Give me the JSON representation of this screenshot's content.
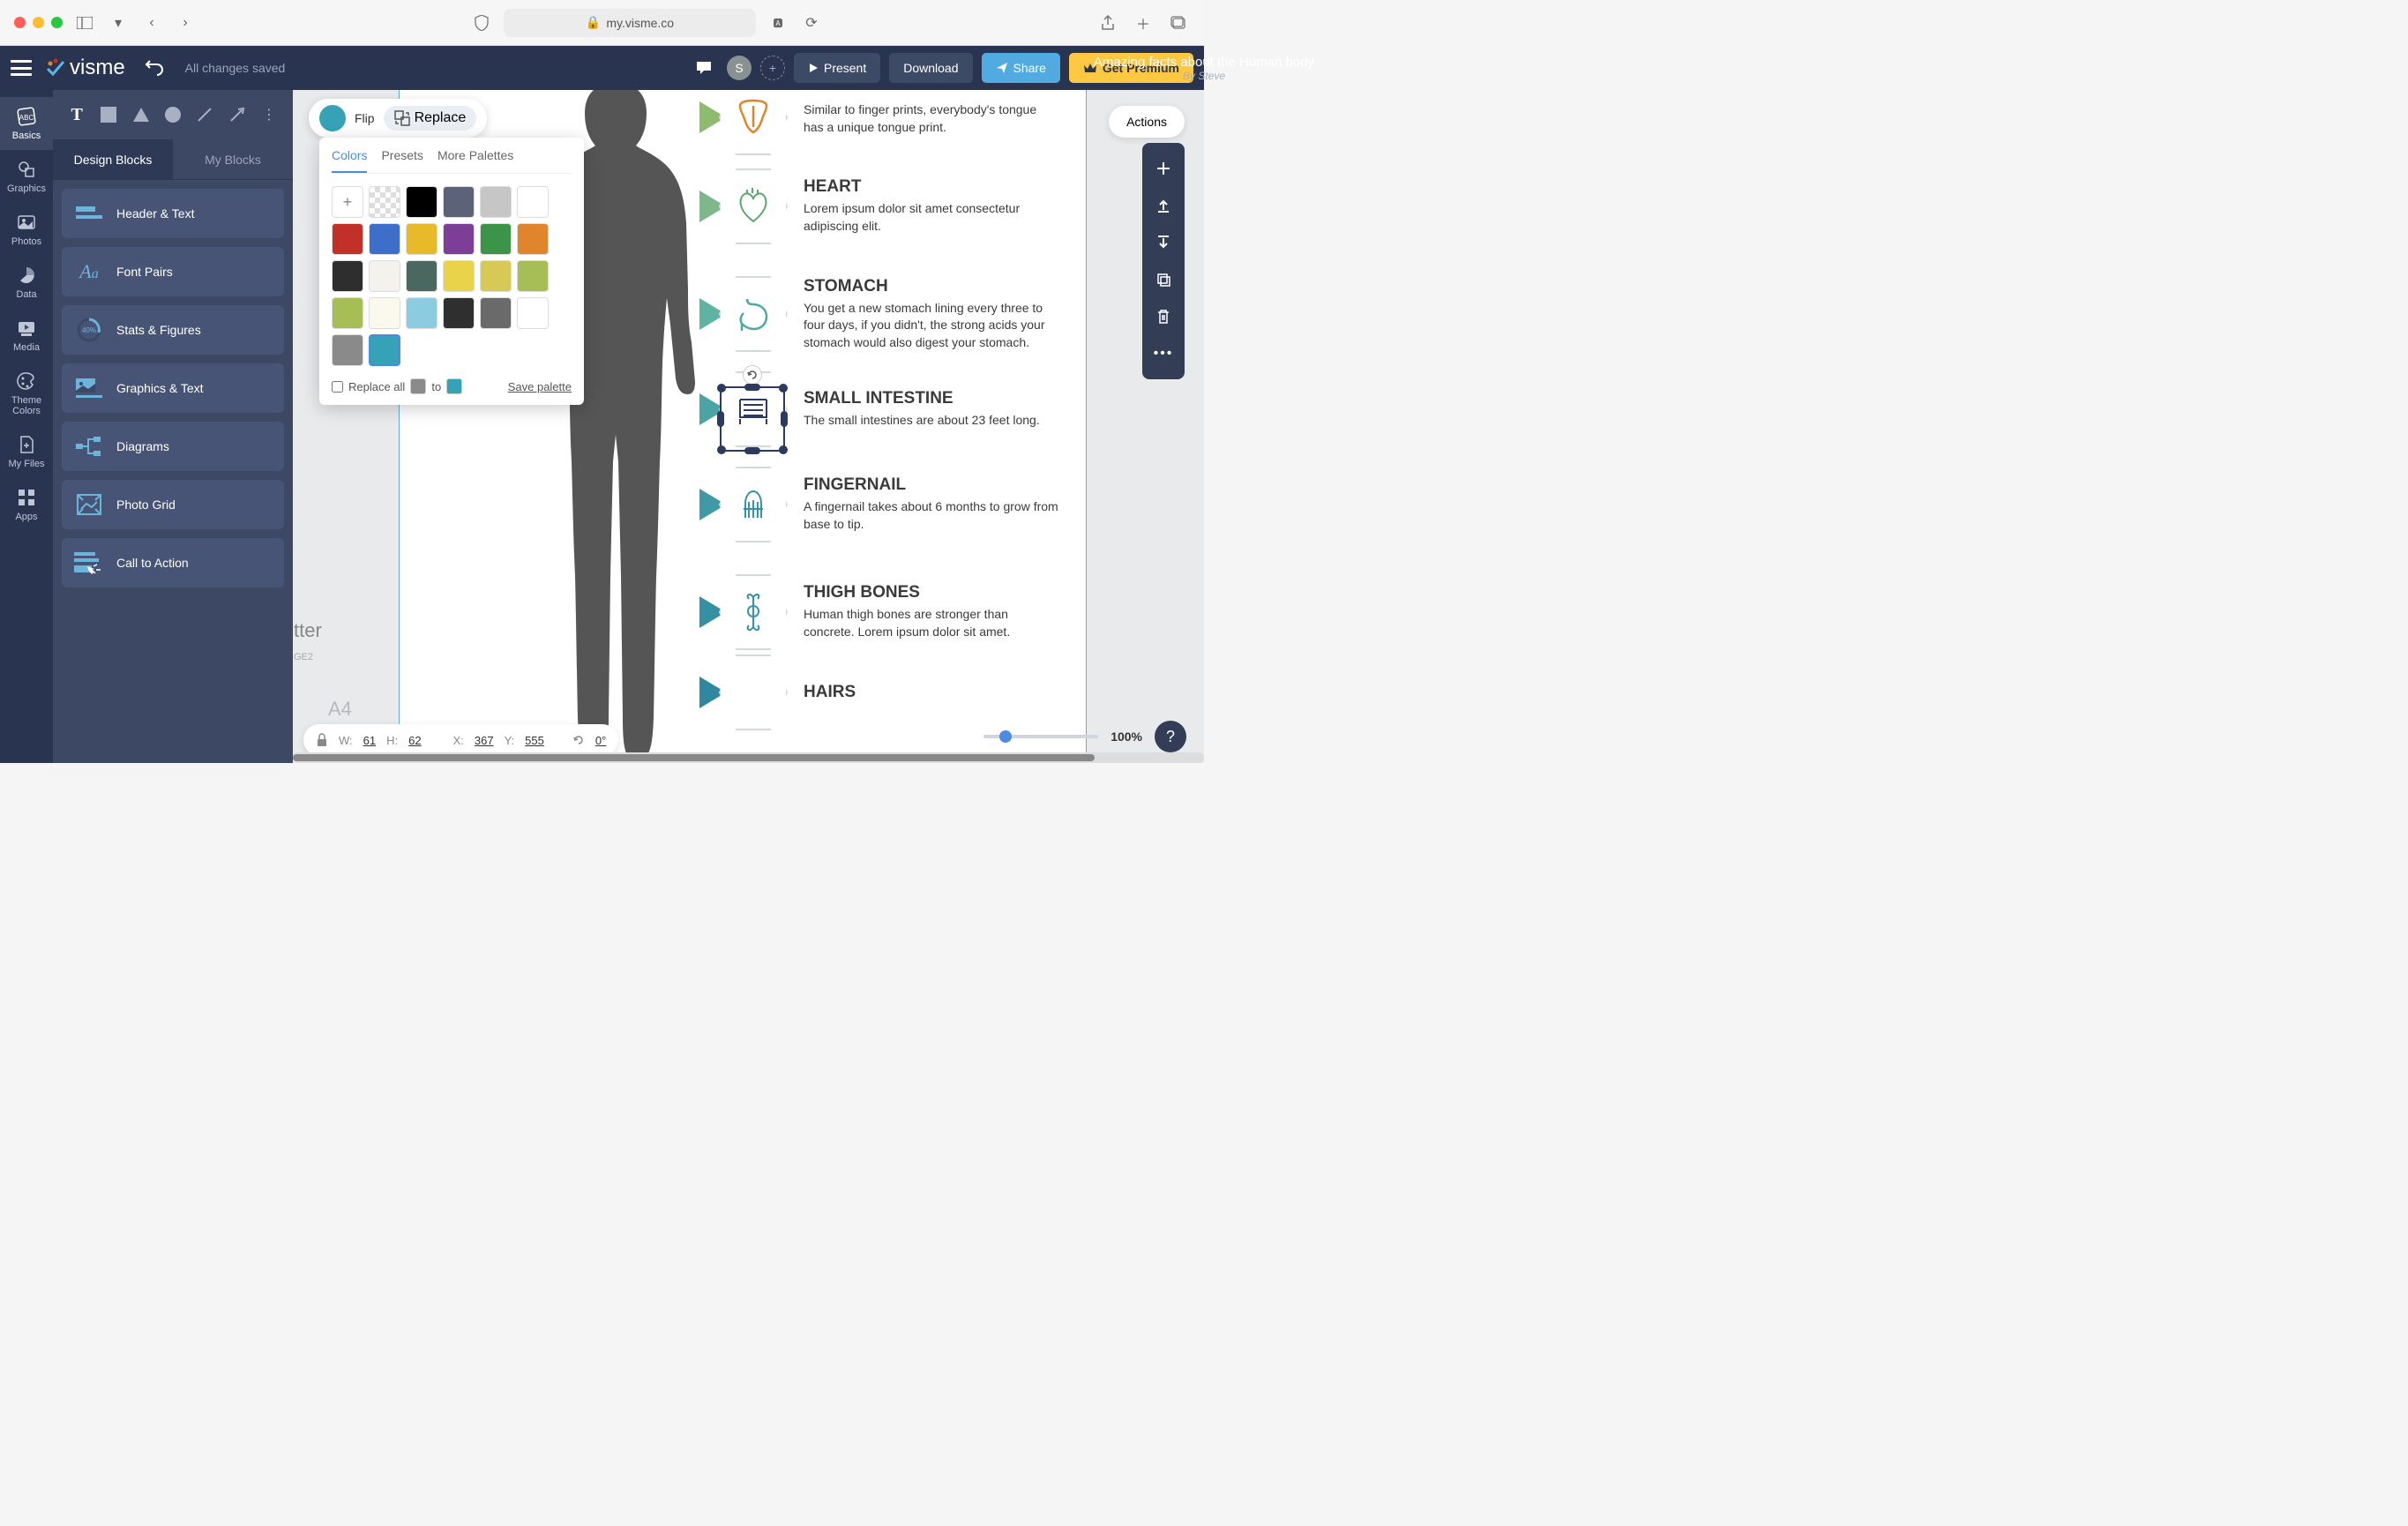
{
  "browser": {
    "url": "my.visme.co",
    "lock_icon": "🔒"
  },
  "header": {
    "logo": "visme",
    "save_status": "All changes saved",
    "doc_title": "Amazing facts about the Human body",
    "doc_author": "By Steve",
    "avatar_letter": "S",
    "present": "Present",
    "download": "Download",
    "share": "Share",
    "premium": "Get Premium"
  },
  "rail": {
    "items": [
      {
        "label": "Basics",
        "icon": "abc"
      },
      {
        "label": "Graphics",
        "icon": "shapes"
      },
      {
        "label": "Photos",
        "icon": "photo"
      },
      {
        "label": "Data",
        "icon": "pie"
      },
      {
        "label": "Media",
        "icon": "play"
      },
      {
        "label": "Theme Colors",
        "icon": "palette"
      },
      {
        "label": "My Files",
        "icon": "file"
      },
      {
        "label": "Apps",
        "icon": "grid"
      }
    ]
  },
  "left_panel": {
    "tabs": {
      "design": "Design Blocks",
      "my": "My Blocks"
    },
    "blocks": [
      {
        "label": "Header & Text"
      },
      {
        "label": "Font Pairs"
      },
      {
        "label": "Stats & Figures"
      },
      {
        "label": "Graphics & Text"
      },
      {
        "label": "Diagrams"
      },
      {
        "label": "Photo Grid"
      },
      {
        "label": "Call to Action"
      }
    ]
  },
  "context_toolbar": {
    "flip": "Flip",
    "replace": "Replace",
    "color": "#35a3b5"
  },
  "palette": {
    "tabs": {
      "colors": "Colors",
      "presets": "Presets",
      "more": "More Palettes"
    },
    "swatches": [
      "add",
      "transparent",
      "#000000",
      "#5c6277",
      "#c6c6c6",
      "#ffffff",
      "#c23127",
      "#3d6ec9",
      "#e7b92b",
      "#7d3e98",
      "#3b9447",
      "#e0852b",
      "#2e2e2e",
      "#f4f2ec",
      "#4a685f",
      "#e8d34a",
      "#d7c956",
      "#a6be55",
      "#a6be55",
      "#fbf8ee",
      "#8dcbe0",
      "#2f2f2f",
      "#6a6a6a",
      "#ffffff",
      "#8a8a8a",
      "#35a3b5"
    ],
    "selected_index": 25,
    "replace_all": "Replace all",
    "to": "to",
    "save": "Save palette",
    "from_color": "#8a8a8a",
    "to_color": "#35a3b5"
  },
  "actions_btn": "Actions",
  "body_items": [
    {
      "title": "",
      "desc": "Similar to finger prints, everybody's tongue has a unique tongue print.",
      "color": "#e08a2f"
    },
    {
      "title": "HEART",
      "desc": "Lorem ipsum dolor sit amet consectetur adipiscing elit.",
      "color": "#5aa86e"
    },
    {
      "title": "STOMACH",
      "desc": "You get a new stomach lining every three to four days, if you didn't, the strong acids your stomach would also digest your stomach.",
      "color": "#4caaa0"
    },
    {
      "title": "SMALL INTESTINE",
      "desc": "The small intestines are about 23 feet long.",
      "color": "#2b3a5e"
    },
    {
      "title": "FINGERNAIL",
      "desc": "A fingernail takes about 6 months to grow from base to tip.",
      "color": "#3593a8"
    },
    {
      "title": "THIGH BONES",
      "desc": "Human thigh bones are stronger than concrete. Lorem ipsum dolor sit amet.",
      "color": "#3593a8"
    },
    {
      "title": "HAIRS",
      "desc": "",
      "color": "#3593a8"
    }
  ],
  "bottom_bar": {
    "w_lbl": "W:",
    "w": "61",
    "h_lbl": "H:",
    "h": "62",
    "x_lbl": "X:",
    "x": "367",
    "y_lbl": "Y:",
    "y": "555",
    "r_lbl": "",
    "r": "0°"
  },
  "zoom": "100%",
  "a4": "A4",
  "page_size": "GE2",
  "tter": "tter"
}
